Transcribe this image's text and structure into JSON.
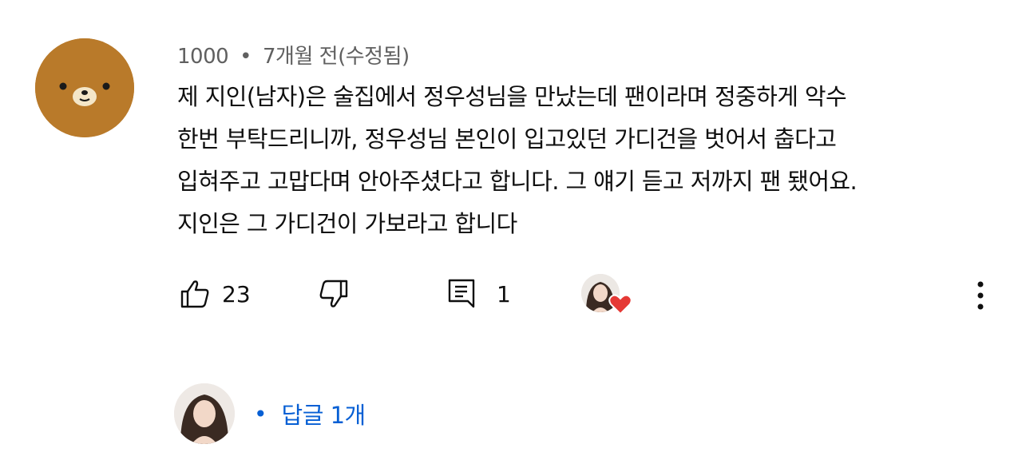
{
  "comment": {
    "author": "1000",
    "separator": "•",
    "time": "7개월 전(수정됨)",
    "lines": [
      "제 지인(남자)은 술집에서 정우성님을 만났는데 팬이라며 정중하게 악수",
      "한번 부탁드리니까, 정우성님 본인이 입고있던 가디건을 벗어서 춥다고",
      "입혀주고 고맙다며 안아주셨다고 합니다. 그 얘기 듣고 저까지 팬 됐어요.",
      "지인은 그 가디건이 가보라고 합니다"
    ]
  },
  "actions": {
    "like_count": "23",
    "reply_count": "1"
  },
  "replies": {
    "separator": "•",
    "label": "답글 1개"
  },
  "colors": {
    "avatar_bg": "#b97a2a",
    "meta_text": "#606060",
    "link_blue": "#065fd4",
    "heart_red": "#e53935"
  },
  "icons": {
    "like": "thumbs-up-icon",
    "dislike": "thumbs-down-icon",
    "reply": "reply-comment-icon",
    "more": "vertical-dots-icon",
    "heart": "heart-icon"
  }
}
